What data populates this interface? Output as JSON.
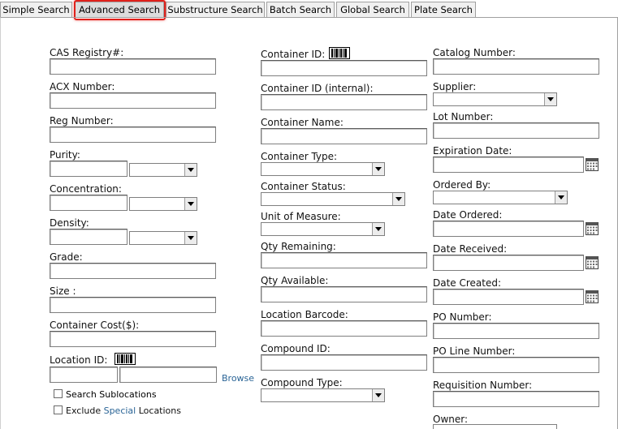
{
  "tabs": [
    {
      "label": "Simple Search",
      "active": false
    },
    {
      "label": "Advanced Search",
      "active": true
    },
    {
      "label": "Substructure Search",
      "active": false
    },
    {
      "label": "Batch Search",
      "active": false
    },
    {
      "label": "Global Search",
      "active": false
    },
    {
      "label": "Plate Search",
      "active": false
    }
  ],
  "highlight_color": "#e0201b",
  "col1": {
    "cas": "CAS Registry#:",
    "acx": "ACX Number:",
    "reg": "Reg Number:",
    "purity": "Purity:",
    "concentration": "Concentration:",
    "density": "Density:",
    "grade": "Grade:",
    "size": "Size :",
    "cost": "Container Cost($):",
    "location_id": "Location ID:",
    "browse": "Browse",
    "search_sub": "Search Sublocations",
    "exclude_pre": "Exclude ",
    "exclude_special": "Special",
    "exclude_post": " Locations"
  },
  "col2": {
    "container_id": "Container ID:",
    "container_id_internal": "Container ID (internal):",
    "container_name": "Container Name:",
    "container_type": "Container Type:",
    "container_status": "Container Status:",
    "unit_of_measure": "Unit of Measure:",
    "qty_remaining": "Qty Remaining:",
    "qty_available": "Qty Available:",
    "location_barcode": "Location Barcode:",
    "compound_id": "Compound ID:",
    "compound_type": "Compound Type:"
  },
  "col3": {
    "catalog_number": "Catalog Number:",
    "supplier": "Supplier:",
    "lot_number": "Lot Number:",
    "expiration_date": "Expiration Date:",
    "ordered_by": "Ordered By:",
    "date_ordered": "Date Ordered:",
    "date_received": "Date Received:",
    "date_created": "Date Created:",
    "po_number": "PO Number:",
    "po_line_number": "PO Line Number:",
    "requisition_number": "Requisition Number:",
    "owner": "Owner:"
  },
  "icons": {
    "barcode": "barcode-icon",
    "calendar": "calendar-icon",
    "dropdown": "chevron-down-icon"
  }
}
